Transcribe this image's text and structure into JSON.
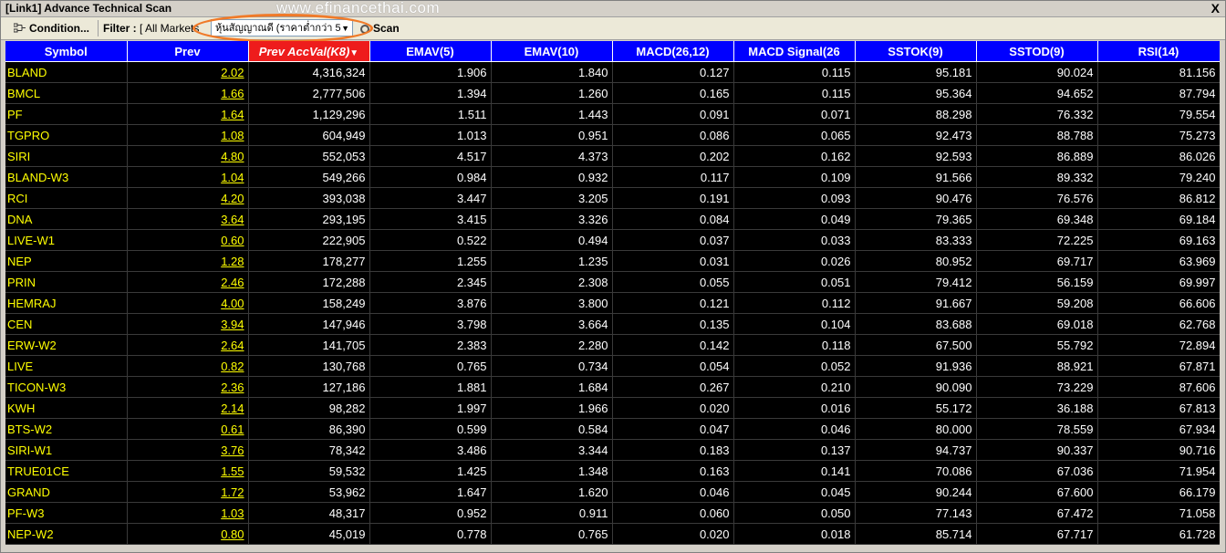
{
  "window": {
    "title": "[Link1] Advance Technical Scan",
    "watermark": "www.efinancethai.com",
    "close_glyph": "X"
  },
  "toolbar": {
    "condition_label": "Condition...",
    "filter_label": "Filter :",
    "filter_value": "[ All Markets ]",
    "strategy_value": "หุ้นสัญญาณดี (ราคาต่ำกว่า 5",
    "scan_label": "Scan",
    "highlight_color": "#f07a28"
  },
  "colors": {
    "header_bg": "#0000ff",
    "sorted_header_bg": "#ee1c1c",
    "symbol_text": "#ffff00",
    "value_text": "#ffffff",
    "grid_bg": "#000000"
  },
  "table": {
    "columns": [
      {
        "label": "Symbol"
      },
      {
        "label": "Prev"
      },
      {
        "label": "Prev AccVal(K8)",
        "sorted": true,
        "sort_glyph": "▼"
      },
      {
        "label": "EMAV(5)"
      },
      {
        "label": "EMAV(10)"
      },
      {
        "label": "MACD(26,12)"
      },
      {
        "label": "MACD Signal(26"
      },
      {
        "label": "SSTOK(9)"
      },
      {
        "label": "SSTOD(9)"
      },
      {
        "label": "RSI(14)"
      }
    ],
    "rows": [
      [
        "BLAND",
        "2.02",
        "4,316,324",
        "1.906",
        "1.840",
        "0.127",
        "0.115",
        "95.181",
        "90.024",
        "81.156"
      ],
      [
        "BMCL",
        "1.66",
        "2,777,506",
        "1.394",
        "1.260",
        "0.165",
        "0.115",
        "95.364",
        "94.652",
        "87.794"
      ],
      [
        "PF",
        "1.64",
        "1,129,296",
        "1.511",
        "1.443",
        "0.091",
        "0.071",
        "88.298",
        "76.332",
        "79.554"
      ],
      [
        "TGPRO",
        "1.08",
        "604,949",
        "1.013",
        "0.951",
        "0.086",
        "0.065",
        "92.473",
        "88.788",
        "75.273"
      ],
      [
        "SIRI",
        "4.80",
        "552,053",
        "4.517",
        "4.373",
        "0.202",
        "0.162",
        "92.593",
        "86.889",
        "86.026"
      ],
      [
        "BLAND-W3",
        "1.04",
        "549,266",
        "0.984",
        "0.932",
        "0.117",
        "0.109",
        "91.566",
        "89.332",
        "79.240"
      ],
      [
        "RCI",
        "4.20",
        "393,038",
        "3.447",
        "3.205",
        "0.191",
        "0.093",
        "90.476",
        "76.576",
        "86.812"
      ],
      [
        "DNA",
        "3.64",
        "293,195",
        "3.415",
        "3.326",
        "0.084",
        "0.049",
        "79.365",
        "69.348",
        "69.184"
      ],
      [
        "LIVE-W1",
        "0.60",
        "222,905",
        "0.522",
        "0.494",
        "0.037",
        "0.033",
        "83.333",
        "72.225",
        "69.163"
      ],
      [
        "NEP",
        "1.28",
        "178,277",
        "1.255",
        "1.235",
        "0.031",
        "0.026",
        "80.952",
        "69.717",
        "63.969"
      ],
      [
        "PRIN",
        "2.46",
        "172,288",
        "2.345",
        "2.308",
        "0.055",
        "0.051",
        "79.412",
        "56.159",
        "69.997"
      ],
      [
        "HEMRAJ",
        "4.00",
        "158,249",
        "3.876",
        "3.800",
        "0.121",
        "0.112",
        "91.667",
        "59.208",
        "66.606"
      ],
      [
        "CEN",
        "3.94",
        "147,946",
        "3.798",
        "3.664",
        "0.135",
        "0.104",
        "83.688",
        "69.018",
        "62.768"
      ],
      [
        "ERW-W2",
        "2.64",
        "141,705",
        "2.383",
        "2.280",
        "0.142",
        "0.118",
        "67.500",
        "55.792",
        "72.894"
      ],
      [
        "LIVE",
        "0.82",
        "130,768",
        "0.765",
        "0.734",
        "0.054",
        "0.052",
        "91.936",
        "88.921",
        "67.871"
      ],
      [
        "TICON-W3",
        "2.36",
        "127,186",
        "1.881",
        "1.684",
        "0.267",
        "0.210",
        "90.090",
        "73.229",
        "87.606"
      ],
      [
        "KWH",
        "2.14",
        "98,282",
        "1.997",
        "1.966",
        "0.020",
        "0.016",
        "55.172",
        "36.188",
        "67.813"
      ],
      [
        "BTS-W2",
        "0.61",
        "86,390",
        "0.599",
        "0.584",
        "0.047",
        "0.046",
        "80.000",
        "78.559",
        "67.934"
      ],
      [
        "SIRI-W1",
        "3.76",
        "78,342",
        "3.486",
        "3.344",
        "0.183",
        "0.137",
        "94.737",
        "90.337",
        "90.716"
      ],
      [
        "TRUE01CE",
        "1.55",
        "59,532",
        "1.425",
        "1.348",
        "0.163",
        "0.141",
        "70.086",
        "67.036",
        "71.954"
      ],
      [
        "GRAND",
        "1.72",
        "53,962",
        "1.647",
        "1.620",
        "0.046",
        "0.045",
        "90.244",
        "67.600",
        "66.179"
      ],
      [
        "PF-W3",
        "1.03",
        "48,317",
        "0.952",
        "0.911",
        "0.060",
        "0.050",
        "77.143",
        "67.472",
        "71.058"
      ],
      [
        "NEP-W2",
        "0.80",
        "45,019",
        "0.778",
        "0.765",
        "0.020",
        "0.018",
        "85.714",
        "67.717",
        "61.728"
      ]
    ]
  }
}
